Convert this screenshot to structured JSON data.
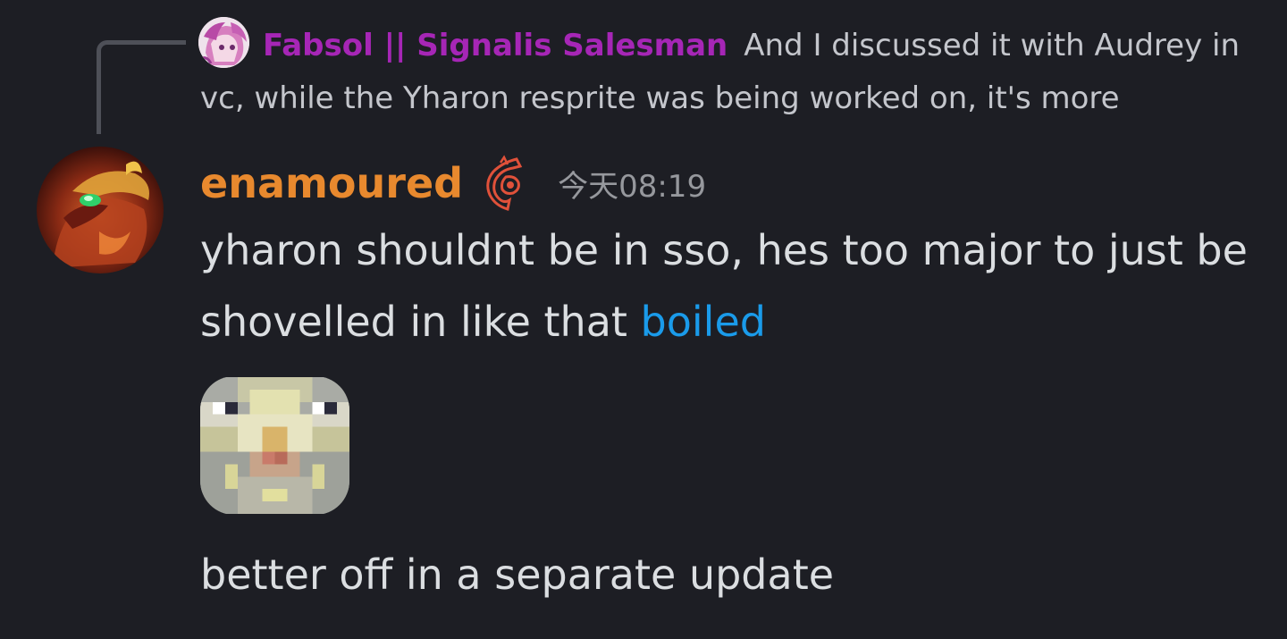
{
  "reply": {
    "author": "Fabsol || Signalis Salesman",
    "text": "And I discussed it with Audrey in vc, while the Yharon resprite was being worked on, it's more",
    "author_color": "#a626b6"
  },
  "message": {
    "author": "enamoured",
    "author_color": "#e8892e",
    "role_icon": "flame-emblem-icon",
    "timestamp": "今天08:19",
    "line1_text": "yharon shouldnt be in sso, hes too major to just be shovelled in like that ",
    "link_text": "boiled",
    "link_color": "#1a9bea",
    "emoji": "pixelated-cat-face-emoji",
    "line2_text": "better off in a separate update"
  },
  "colors": {
    "background": "#1d1e24",
    "text": "#dbdee1",
    "muted": "#96989d"
  }
}
